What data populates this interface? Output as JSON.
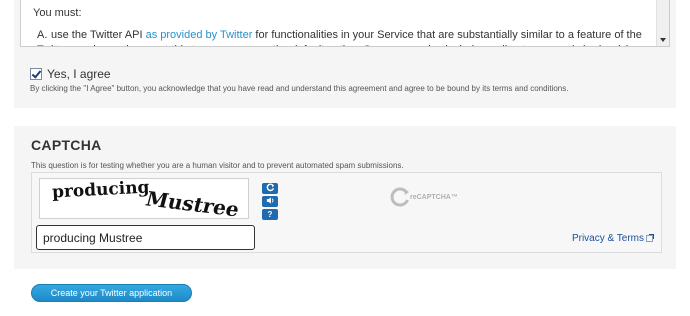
{
  "terms": {
    "must_label": "You must:",
    "item_letter": "A.",
    "item_text_before": "use the Twitter API ",
    "item_link": "as provided by Twitter",
    "item_text_after": " for functionalities in your Service that are substantially similar to a feature of the Twitter service and present this to your users as the default option. Some examples include media storage and sharing (via twitter.com), trending topics, and"
  },
  "agreement": {
    "checked": true,
    "checkbox_label": "Yes, I agree",
    "note": "By clicking the \"I Agree\" button, you acknowledge that you have read and understand this agreement and agree to be bound by its terms and conditions."
  },
  "captcha": {
    "title": "CAPTCHA",
    "description": "This question is for testing whether you are a human visitor and to prevent automated spam submissions.",
    "image_word_1": "producing",
    "image_word_2": "Mustree",
    "input_value": "producing Mustree",
    "buttons": [
      "refresh-icon",
      "audio-icon",
      "help-icon"
    ],
    "logo_text": "reCAPTCHA™",
    "privacy_link": "Privacy & Terms"
  },
  "submit": {
    "label": "Create your Twitter application"
  },
  "colors": {
    "link": "#2b90c8",
    "button": "#1e8ac8",
    "captcha_button": "#1f6bb0"
  }
}
